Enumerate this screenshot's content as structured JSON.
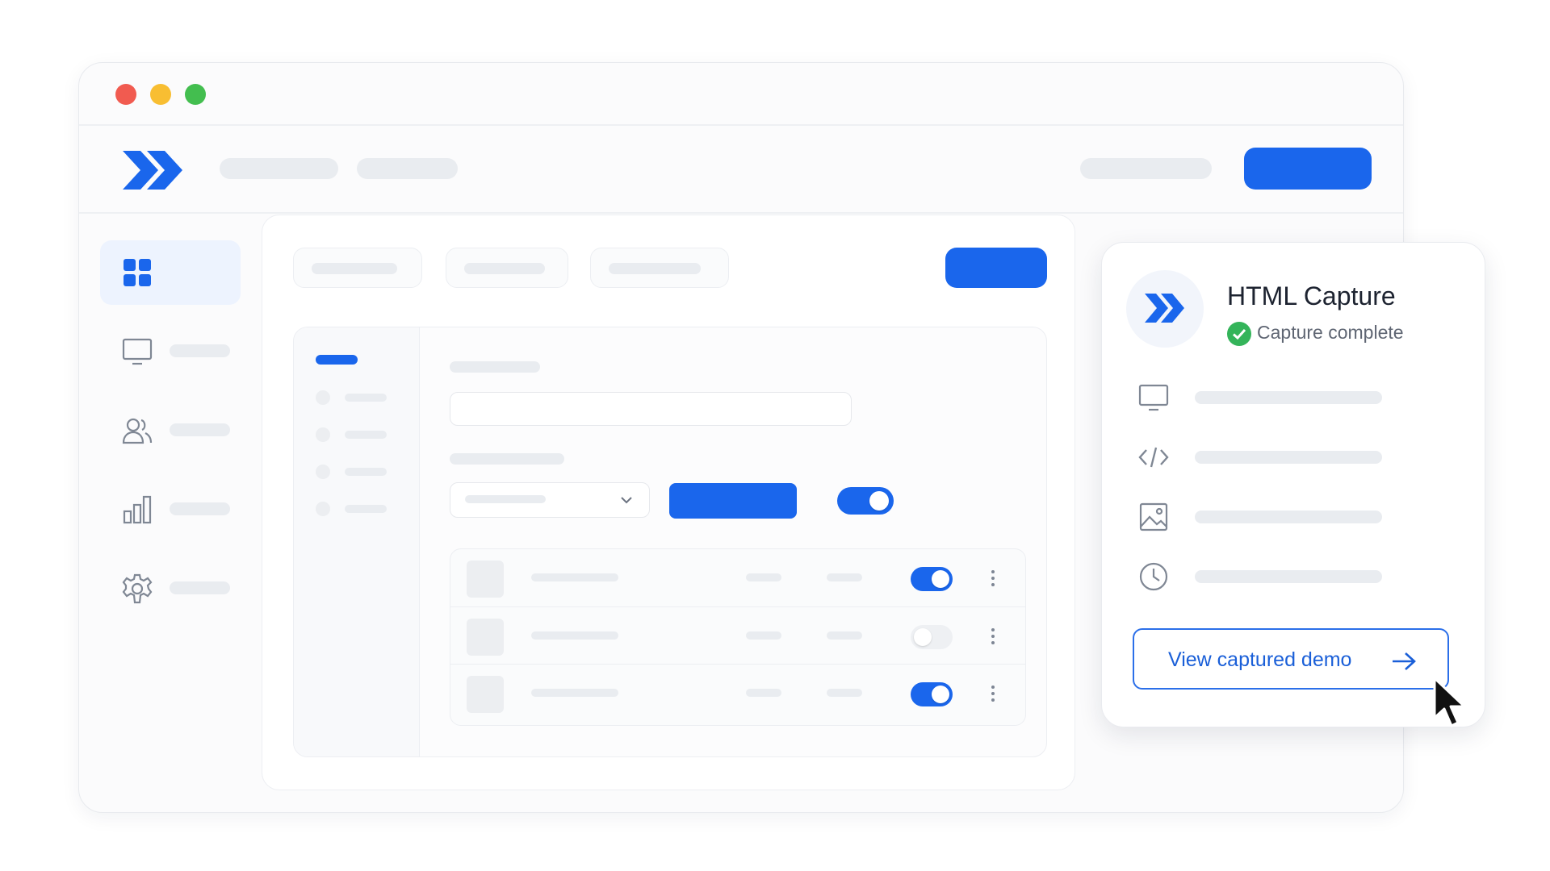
{
  "window": {
    "traffic_lights": {
      "close_color": "#f15b50",
      "minimize_color": "#f8be32",
      "zoom_color": "#43be4f"
    }
  },
  "app": {
    "brand_color": "#1a66ec",
    "logo_icon": "double-chevron-right-icon"
  },
  "sidebar": {
    "items": [
      {
        "icon": "grid-icon",
        "active": true
      },
      {
        "icon": "monitor-icon",
        "active": false
      },
      {
        "icon": "users-icon",
        "active": false
      },
      {
        "icon": "bar-chart-icon",
        "active": false
      },
      {
        "icon": "gear-icon",
        "active": false
      }
    ]
  },
  "table": {
    "rows": [
      {
        "toggle_on": true
      },
      {
        "toggle_on": false
      },
      {
        "toggle_on": true
      }
    ]
  },
  "form": {
    "toggle_on": true
  },
  "capture_card": {
    "title": "HTML Capture",
    "status": "Capture complete",
    "status_color": "#34b45a",
    "rows": [
      {
        "icon": "monitor-icon"
      },
      {
        "icon": "code-icon"
      },
      {
        "icon": "image-icon"
      },
      {
        "icon": "clock-icon"
      }
    ],
    "button_label": "View captured demo",
    "button_icon": "arrow-right-icon"
  }
}
